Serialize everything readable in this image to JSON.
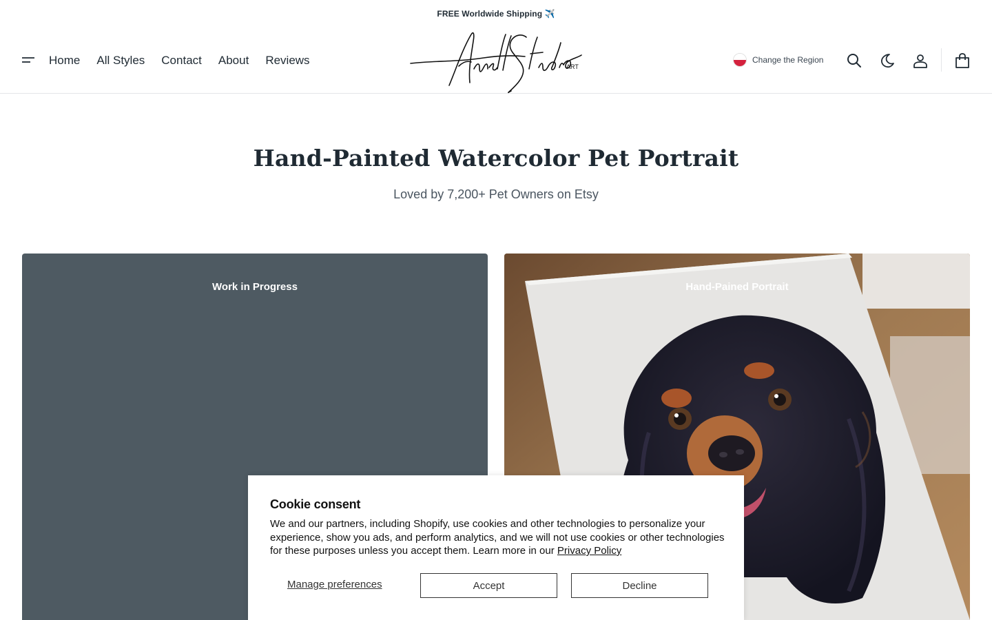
{
  "announcement": "FREE Worldwide Shipping ✈️",
  "nav": {
    "items": [
      {
        "label": "Home"
      },
      {
        "label": "All Styles"
      },
      {
        "label": "Contact"
      },
      {
        "label": "About"
      },
      {
        "label": "Reviews"
      }
    ]
  },
  "logo": {
    "script": "Anell Studio",
    "tag": "ART"
  },
  "region": {
    "label": "Change the Region"
  },
  "header_icons": [
    "menu-icon",
    "search-icon",
    "moon-icon",
    "user-icon",
    "bag-icon"
  ],
  "hero": {
    "title": "Hand-Painted Watercolor Pet Portrait",
    "subtitle": "Loved by 7,200+ Pet Owners on Etsy"
  },
  "cards": [
    {
      "label": "Work in Progress"
    },
    {
      "label": "Hand-Pained Portrait"
    }
  ],
  "cookie": {
    "title": "Cookie consent",
    "body": "We and our partners, including Shopify, use cookies and other technologies to personalize your experience, show you ads, and perform analytics, and we will not use cookies or other technologies for these purposes unless you accept them. Learn more in our ",
    "policy_link": "Privacy Policy",
    "manage_label": "Manage preferences",
    "accept_label": "Accept",
    "decline_label": "Decline"
  },
  "colors": {
    "text": "#1f2a33",
    "card_left_bg": "#4e5a62",
    "flag_red": "#d4213d"
  }
}
